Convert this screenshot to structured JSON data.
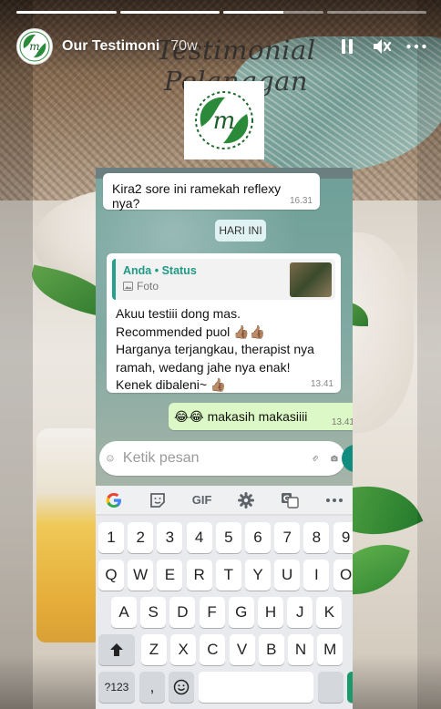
{
  "story": {
    "progress": [
      1,
      1,
      0.6,
      0
    ],
    "account_name": "Our Testimoni",
    "post_time": "70w",
    "banner_title": "Testimonial Pelanggan",
    "controls": {
      "pause_icon": "pause-icon",
      "mute_icon": "volume-muted-icon",
      "more_icon": "more-icon"
    }
  },
  "chat": {
    "prev_message": "Kira2 sore ini ramekah reflexy nya?",
    "prev_time": "16.31",
    "date_label": "HARI INI",
    "reply": {
      "quote_title": "Anda • Status",
      "quote_sub": "Foto",
      "lines": [
        "Akuu testiii dong mas.",
        "Recommended puol 👍🏽👍🏽",
        "Harganya terjangkau, therapist nya",
        "ramah, wedang jahe nya enak!",
        "Kenek dibaleni~ 👍🏽"
      ],
      "time": "13.41"
    },
    "sent": {
      "text": "😂😂 makasih makasiiii",
      "time": "13.41"
    },
    "input_placeholder": "Ketik pesan"
  },
  "keyboard": {
    "toolbar": [
      "google-g-icon",
      "sticker-icon",
      "GIF",
      "settings-icon",
      "translate-icon",
      "more-horizontal-icon"
    ],
    "gif_label": "GIF",
    "row_numbers": [
      "1",
      "2",
      "3",
      "4",
      "5",
      "6",
      "7",
      "8",
      "9"
    ],
    "row_q": [
      "Q",
      "W",
      "E",
      "R",
      "T",
      "Y",
      "U",
      "I",
      "O"
    ],
    "row_a": [
      "A",
      "S",
      "D",
      "F",
      "G",
      "H",
      "J",
      "K"
    ],
    "row_z": [
      "Z",
      "X",
      "C",
      "V",
      "B",
      "N",
      "M"
    ],
    "symbols_label": "?123",
    "comma_label": ","
  },
  "colors": {
    "whatsapp_green": "#25a08d",
    "sent_bubble": "#dcf8c6",
    "keyboard_bg": "#e8eaed"
  }
}
